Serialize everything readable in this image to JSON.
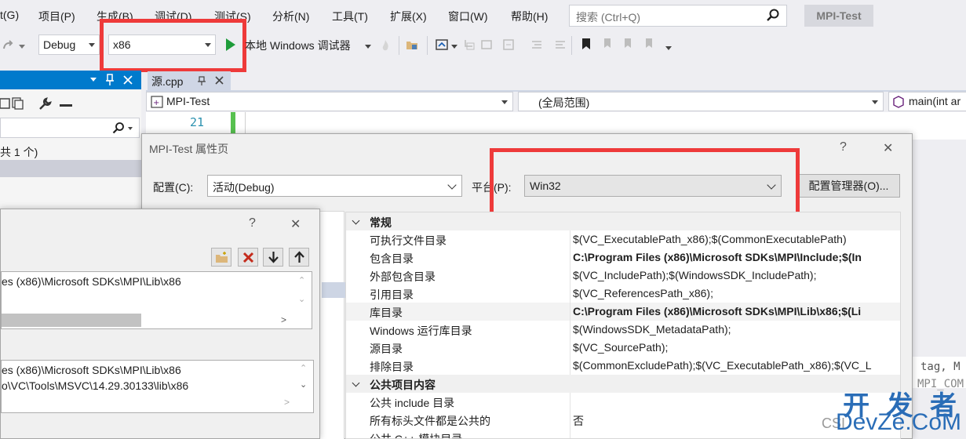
{
  "menubar": {
    "items": [
      "t(G)",
      "项目(P)",
      "生成(B)",
      "调试(D)",
      "测试(S)",
      "分析(N)",
      "工具(T)",
      "扩展(X)",
      "窗口(W)",
      "帮助(H)"
    ],
    "search_placeholder": "搜索 (Ctrl+Q)",
    "project_name": "MPI-Test"
  },
  "toolbar": {
    "config": "Debug",
    "platform": "x86",
    "debugger": "本地 Windows 调试器"
  },
  "left_pane": {
    "count_text": "共 1 个)"
  },
  "editor": {
    "tab_label": "源.cpp",
    "nav_project": "MPI-Test",
    "nav_scope": "(全局范围)",
    "nav_member": "main(int ar",
    "line_number": "21"
  },
  "prop_dialog": {
    "title": "MPI-Test 属性页",
    "help": "?",
    "close": "✕",
    "config_label": "配置(C):",
    "config_value": "活动(Debug)",
    "platform_label": "平台(P):",
    "platform_value": "Win32",
    "config_manager": "配置管理器(O)..."
  },
  "prop_grid": {
    "categories": [
      "常规",
      "公共项目内容"
    ],
    "rows": [
      {
        "name": "可执行文件目录",
        "value": "$(VC_ExecutablePath_x86);$(CommonExecutablePath)"
      },
      {
        "name": "包含目录",
        "value": "C:\\Program Files (x86)\\Microsoft SDKs\\MPI\\Include;$(In"
      },
      {
        "name": "外部包含目录",
        "value": "$(VC_IncludePath);$(WindowsSDK_IncludePath);"
      },
      {
        "name": "引用目录",
        "value": "$(VC_ReferencesPath_x86);"
      },
      {
        "name": "库目录",
        "value": "C:\\Program Files (x86)\\Microsoft SDKs\\MPI\\Lib\\x86;$(Li"
      },
      {
        "name": "Windows 运行库目录",
        "value": "$(WindowsSDK_MetadataPath);"
      },
      {
        "name": "源目录",
        "value": "$(VC_SourcePath);"
      },
      {
        "name": "排除目录",
        "value": "$(CommonExcludePath);$(VC_ExecutablePath_x86);$(VC_L"
      }
    ],
    "common_rows": [
      {
        "name": "公共 include 目录",
        "value": ""
      },
      {
        "name": "所有标头文件都是公共的",
        "value": "否"
      },
      {
        "name": "公共 C++ 模块目录",
        "value": ""
      }
    ]
  },
  "lib_dialog": {
    "help": "?",
    "close": "✕",
    "top_list": [
      "es (x86)\\Microsoft SDKs\\MPI\\Lib\\x86"
    ],
    "bottom_list": [
      "es (x86)\\Microsoft SDKs\\MPI\\Lib\\x86",
      "o\\VC\\Tools\\MSVC\\14.29.30133\\lib\\x86"
    ]
  },
  "code_peek": {
    "line1": "tag, M",
    "line2": "MPI_COM"
  },
  "watermark": {
    "main": "开 发 者",
    "sub": "DevZe.CoM",
    "prefix": "CSI"
  },
  "colors": {
    "accent": "#007acc",
    "highlight_box": "#ee3a3a",
    "watermark": "#2a6db7"
  }
}
